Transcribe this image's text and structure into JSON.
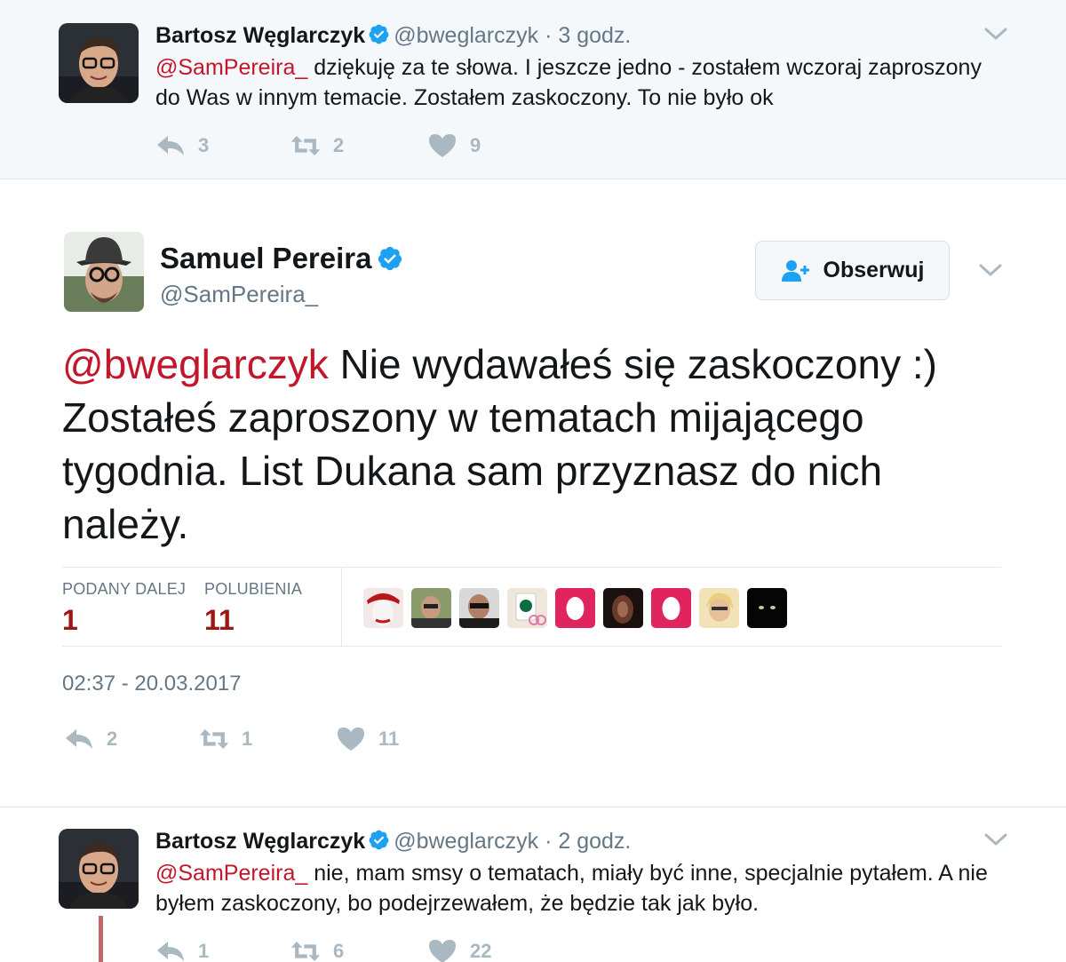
{
  "top_tweet": {
    "name": "Bartosz Węglarczyk",
    "handle": "@bweglarczyk",
    "separator": "·",
    "time": "3 godz.",
    "mention": "@SamPereira_",
    "text": " dziękuję za te słowa. I jeszcze jedno - zostałem wczoraj zaproszony do Was w innym temacie. Zostałem zaskoczony. To nie było ok",
    "replies": "3",
    "retweets": "2",
    "likes": "9"
  },
  "main_tweet": {
    "name": "Samuel Pereira",
    "handle": "@SamPereira_",
    "follow_label": "Obserwuj",
    "mention": "@bweglarczyk",
    "text": " Nie wydawałeś się zaskoczony :) Zostałeś zaproszony w tematach mijającego tygodnia. List Dukana sam przyznasz do nich należy.",
    "stats": {
      "retweets_label": "PODANY DALEJ",
      "retweets_value": "1",
      "likes_label": "POLUBIENIA",
      "likes_value": "11"
    },
    "timestamp": "02:37 - 20.03.2017",
    "replies": "2",
    "retweets": "1",
    "likes": "11"
  },
  "bottom_tweet": {
    "name": "Bartosz Węglarczyk",
    "handle": "@bweglarczyk",
    "separator": "·",
    "time": "2 godz.",
    "mention": "@SamPereira_",
    "text": " nie, mam smsy o tematach, miały być inne, specjalnie pytałem. A nie byłem zaskoczony, bo podejrzewałem, że będzie tak jak było.",
    "replies": "1",
    "retweets": "6",
    "likes": "22"
  },
  "colors": {
    "mention": "#c2162b",
    "stat_value": "#9a1a12",
    "verified": "#1da1f2",
    "muted": "#657786",
    "action_icon": "#aab8c2"
  },
  "icons": [
    "verified-badge-icon",
    "reply-icon",
    "retweet-icon",
    "heart-icon",
    "chevron-down-icon",
    "follow-user-icon"
  ]
}
